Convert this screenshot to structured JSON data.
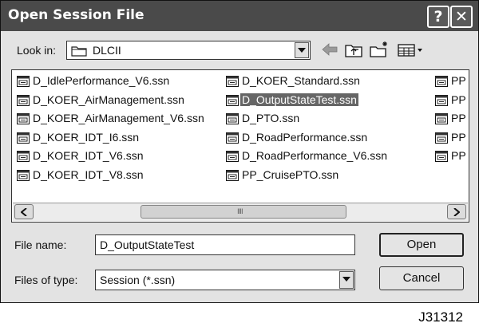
{
  "window": {
    "title": "Open Session File",
    "help_glyph": "?",
    "close_glyph": "✕"
  },
  "look_in": {
    "label": "Look in:",
    "value": "DLCII",
    "icon": "folder-icon"
  },
  "toolbar": {
    "icons": [
      "back-arrow-icon",
      "up-folder-icon",
      "new-folder-icon",
      "view-menu-icon"
    ]
  },
  "files": {
    "column1": [
      "D_IdlePerformance_V6.ssn",
      "D_KOER_AirManagement.ssn",
      "D_KOER_AirManagement_V6.ssn",
      "D_KOER_IDT_I6.ssn",
      "D_KOER_IDT_V6.ssn",
      "D_KOER_IDT_V8.ssn"
    ],
    "column2": [
      "D_KOER_Standard.ssn",
      "D_OutputStateTest.ssn",
      "D_PTO.ssn",
      "D_RoadPerformance.ssn",
      "D_RoadPerformance_V6.ssn",
      "PP_CruisePTO.ssn"
    ],
    "column3": [
      "PP",
      "PP",
      "PP",
      "PP",
      "PP"
    ],
    "selected": "D_OutputStateTest.ssn",
    "file_icon": "session-file-icon",
    "scroll_grip": "IIII"
  },
  "file_name": {
    "label": "File name:",
    "value": "D_OutputStateTest"
  },
  "file_type": {
    "label": "Files of type:",
    "value": "Session (*.ssn)"
  },
  "buttons": {
    "open": "Open",
    "cancel": "Cancel"
  },
  "figure_id": "J31312",
  "colors": {
    "titlebar": "#4a4a4a",
    "dialog_bg": "#e3e3e3",
    "selection": "#666666"
  }
}
